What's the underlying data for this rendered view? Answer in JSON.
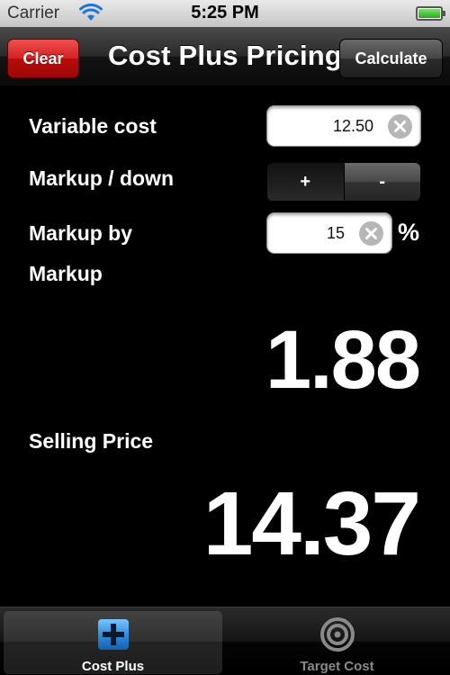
{
  "status_bar": {
    "carrier": "Carrier",
    "time": "5:25 PM",
    "wifi_icon": "wifi-icon",
    "battery_icon": "battery-icon"
  },
  "nav": {
    "title": "Cost Plus Pricing",
    "clear_label": "Clear",
    "calculate_label": "Calculate"
  },
  "form": {
    "variable_cost_label": "Variable cost",
    "variable_cost_value": "12.50",
    "markup_direction_label": "Markup / down",
    "markup_options": [
      "+",
      "-"
    ],
    "markup_selected": "+",
    "markup_by_label": "Markup by",
    "markup_by_value": "15",
    "percent_symbol": "%"
  },
  "results": {
    "markup_label": "Markup",
    "markup_value": "1.88",
    "selling_price_label": "Selling Price",
    "selling_price_value": "14.37"
  },
  "tabs": [
    {
      "label": "Cost Plus",
      "icon": "plus-icon",
      "active": true
    },
    {
      "label": "Target Cost",
      "icon": "target-icon",
      "active": false
    }
  ],
  "colors": {
    "clear_button": "#d42020",
    "background": "#000000",
    "active_tab_icon": "#2f8fe0"
  }
}
